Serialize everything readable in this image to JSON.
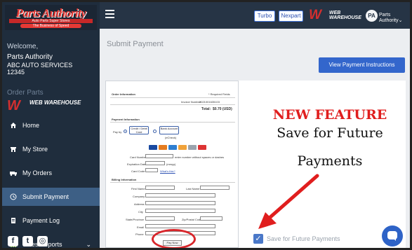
{
  "sidebar": {
    "logo_main": "Parts Authority",
    "logo_sub": "Auto Parts Super Stores",
    "logo_tag": "The Business of Speed",
    "welcome": "Welcome,",
    "company": "Parts Authority",
    "account_name": "ABC AUTO SERVICES",
    "account_number": "12345",
    "order_parts": "Order Parts",
    "ww_mark": "W",
    "ww_text": "WEB WAREHOUSE",
    "items": [
      {
        "label": "Home",
        "icon": "home-icon"
      },
      {
        "label": "My Store",
        "icon": "store-icon"
      },
      {
        "label": "My Orders",
        "icon": "truck-icon"
      },
      {
        "label": "Submit Payment",
        "icon": "clock-icon",
        "active": true
      },
      {
        "label": "Payment Log",
        "icon": "document-icon"
      },
      {
        "label": "Sales Reports",
        "icon": "chart-icon",
        "has_chevron": true
      }
    ],
    "social": [
      "f",
      "t",
      "◎"
    ]
  },
  "topbar": {
    "turbo": "Turbo",
    "nexpart": "Nexpart",
    "ww_mark": "W",
    "ww_text": "WEB WAREHOUSE",
    "avatar": "PA",
    "user_menu": "Parts Authority"
  },
  "main": {
    "page_title": "Submit Payment",
    "instructions_button": "View Payment Instructions",
    "form": {
      "order_info": "Order Information",
      "required": "* Required Fields",
      "invoice_label": "Invoice Number:",
      "invoice_value": "2021001635103",
      "total_label": "Total:",
      "total_value": "$0.70 (USD)",
      "payment_info": "Payment Information",
      "pay_by": "Pay by",
      "credit_card": "Credit / Debit Card",
      "bank_account": "Bank Account",
      "bank_sub": "(eCheck)",
      "card_number": "Card Number",
      "card_hint": "enter number without spaces or dashes",
      "expiration": "Expiration Date",
      "exp_hint": "(mmyy)",
      "card_code": "Card Code",
      "card_code_hint": "What's this?",
      "billing_info": "Billing Information",
      "first_name": "First Name",
      "last_name": "Last Name",
      "company": "Company",
      "address": "Address",
      "city": "City",
      "state": "State/Province",
      "zip": "Zip/Postal Code",
      "email": "Email",
      "phone": "Phone",
      "pay_now": "Pay Now"
    },
    "new_feature": "NEW FEATURE",
    "feature_line1": "Save for Future",
    "feature_line2": "Payments",
    "save_label": "Save for Future Payments",
    "colors": {
      "accent_red": "#e01e1e",
      "button_blue": "#3366cc",
      "sidebar": "#1f2d3d",
      "active_nav": "#3d5f85"
    }
  }
}
